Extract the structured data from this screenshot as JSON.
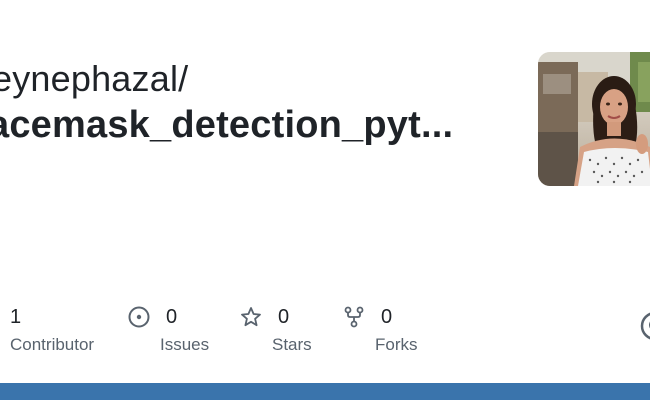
{
  "repo": {
    "owner": "eynephazal/",
    "name": "acemask_detection_pyt..."
  },
  "avatar": {
    "alt": "user-avatar"
  },
  "stats": [
    {
      "count": "1",
      "label": "Contributor",
      "icon": "people-icon"
    },
    {
      "count": "0",
      "label": "Issues",
      "icon": "issue-circle-icon"
    },
    {
      "count": "0",
      "label": "Stars",
      "icon": "star-icon"
    },
    {
      "count": "0",
      "label": "Forks",
      "icon": "fork-icon"
    }
  ],
  "colors": {
    "text": "#1f2328",
    "muted": "#59636e",
    "bar": "#3a74ac"
  }
}
